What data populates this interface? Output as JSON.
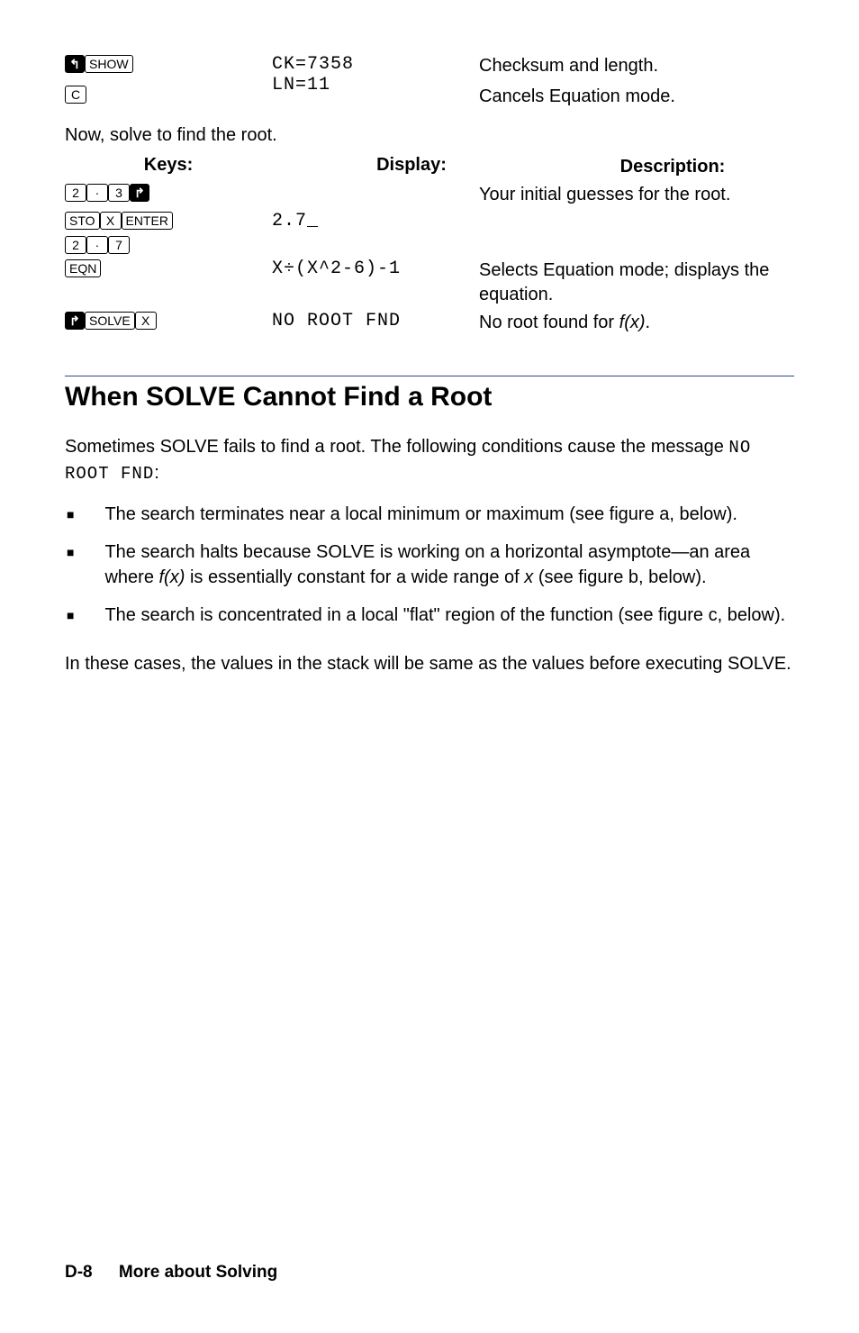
{
  "keys": {
    "shift_left": "↰",
    "shift_right": "↱",
    "show": "SHOW",
    "c": "C",
    "sto": "STO",
    "x": "X",
    "enter": "ENTER",
    "eqn": "EQN",
    "solve": "SOLVE",
    "d2": "2",
    "d3": "3",
    "d7": "7",
    "dot": "·"
  },
  "row_show": {
    "disp_line1": "CK=7358",
    "disp_line2": "LN=11",
    "desc": "Checksum and length."
  },
  "row_c": {
    "desc": "Cancels Equation mode."
  },
  "narr1": "Now, solve to find the root.",
  "headers": {
    "keys": "Keys:",
    "display": "Display:",
    "description": "Description:"
  },
  "row_guess": {
    "desc": "Your initial guesses for the root."
  },
  "row_sto": {
    "disp": "2.7_"
  },
  "row_eqn": {
    "disp": "X÷(X^2-6)-1",
    "desc": "Selects Equation mode; displays the equation."
  },
  "row_solve": {
    "disp": "NO ROOT FND",
    "desc_pre": "No root found for ",
    "desc_fx": "f(x)",
    "desc_post": "."
  },
  "section": {
    "title": "When SOLVE Cannot Find a Root",
    "intro_pre": "Sometimes SOLVE fails to find a root. The following conditions cause the message ",
    "intro_mono": "NO ROOT FND",
    "intro_post": ":",
    "bullet1": "The search terminates near a local minimum or maximum (see figure a, below).",
    "bullet2_pre": "The search halts because SOLVE is working on a horizontal asymptote—an area where ",
    "bullet2_fx": "f(x)",
    "bullet2_mid": " is essentially constant for a wide range of ",
    "bullet2_x": "x",
    "bullet2_post": " (see figure b, below).",
    "bullet3": "The search is concentrated in a local \"flat\" region of the function (see figure c, below).",
    "closing": "In these cases, the values in the stack will be same as the values before executing SOLVE."
  },
  "footer": {
    "page": "D-8",
    "chapter": "More about Solving"
  }
}
